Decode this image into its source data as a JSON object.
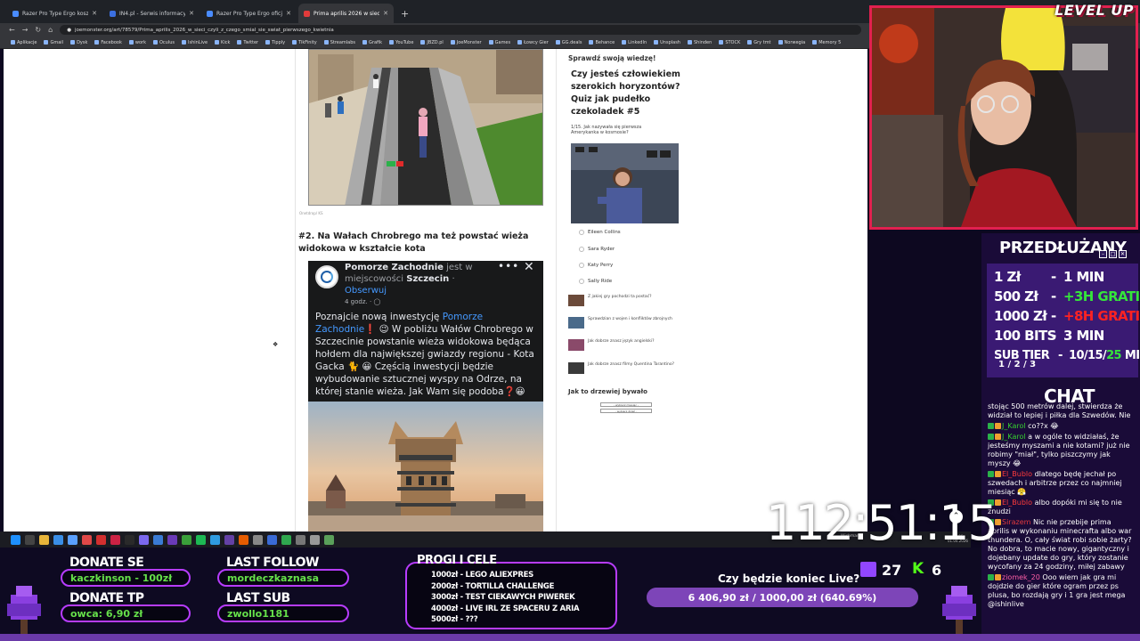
{
  "browser": {
    "tabs": [
      {
        "title": "Razer Pro Type Ergo koszt - Sz",
        "color": "#4a8cff",
        "active": false
      },
      {
        "title": "IN4.pl - Serwis informacyjny | T",
        "color": "#3b6fe0",
        "active": false
      },
      {
        "title": "Razer Pro Type Ergo oficjalnie",
        "color": "#4a8cff",
        "active": false
      },
      {
        "title": "Prima aprilis 2026 w sieci, czyli",
        "color": "#e23b3b",
        "active": true
      }
    ],
    "url": "joemonster.org/art/78579/Prima_aprilis_2026_w_sieci_czyli_z_czego_smial_sie_swiat_pierwszego_kwietnia",
    "bookmarks": [
      "Aplikacje",
      "Gmail",
      "Dysk",
      "Facebook",
      "work",
      "Oculus",
      "IshinLive",
      "Kick",
      "Twitter",
      "Tipply",
      "TikFinity",
      "Streamlabs",
      "Grafik",
      "YouTube",
      "JBZD.pl",
      "JoeMonster",
      "Games",
      "Łowcy Gier",
      "GG.deals",
      "Behance",
      "LinkedIn",
      "Unsplash",
      "Shinden",
      "STOCK",
      "Gry tmt",
      "Norwegia",
      "Memory 5"
    ]
  },
  "article": {
    "photo_credit": "Onetdrop/ KS",
    "heading": "#2. Na Wałach Chrobrego ma też powstać wieża widokowa w kształcie kota",
    "fb": {
      "page_name": "Pomorze Zachodnie",
      "is_in": "jest w miejscowości",
      "city": "Szczecin",
      "follow": "Obserwuj",
      "time": "4 godz. · ",
      "text_1": "Poznajcie nową inwestycję ",
      "text_link": "Pomorze Zachodnie",
      "text_2": "❗ 😉 W pobliżu Wałów Chrobrego w Szczecinie powstanie wieża widokowa będąca hołdem dla największej gwiazdy regionu - Kota Gacka 🐈 😀 Częścią inwestycji będzie wybudowanie sztucznej wyspy na Odrze, na której stanie wieża. Jak Wam się podoba❓😀"
    }
  },
  "sidebar": {
    "section_title": "Sprawdź swoją wiedzę!",
    "quiz_title": "Czy jesteś człowiekiem szerokich horyzontów? Quiz jak pudełko czekoladek #5",
    "question": "1/15. Jak nazywała się pierwsza Amerykanka w kosmosie?",
    "options": [
      "Eileen Collins",
      "Sara Ryder",
      "Katy Perry",
      "Sally Ride"
    ],
    "related": [
      "Z jakiej gry pochodzi ta postać?",
      "Sprawdzian z wojen i konfliktów zbrojnych",
      "Jak dobrze znasz język angielski?",
      "Jak dobrze znasz filmy Quentina Tarantino?"
    ],
    "tree_title": "Jak to drzewiej bywało",
    "select_1": "- wybierz miesiąc -",
    "select_2": "- wybierz dzień -"
  },
  "taskbar": {
    "tray_name": "Wichmann",
    "time": "18:06",
    "date": "01.04.2026"
  },
  "overlay": {
    "brand": "LEVEL UP",
    "extend_title": "PRZEDŁUŻANY",
    "rows": [
      {
        "amount": "1 Zł",
        "reward": "1 MIN",
        "kind": "plain"
      },
      {
        "amount": "500 Zł",
        "reward": "+3H GRATIS",
        "kind": "green"
      },
      {
        "amount": "1000 Zł",
        "reward": "+8H GRATIS",
        "kind": "red"
      },
      {
        "amount": "100 BITS",
        "reward": "3 MIN",
        "kind": "plain"
      }
    ],
    "sub_tier_label": "SUB TIER",
    "sub_tier_levels": "1 / 2 / 3",
    "sub_tier_values": "10/15/",
    "sub_tier_last": "25",
    "sub_tier_unit": " MIN",
    "chat_title": "CHAT",
    "chat": [
      {
        "name": "",
        "text": "stojąc 500 metrów dalej, stwierdza że widział to lepiej i piłka dla Szwedów. Nie",
        "cls": ""
      },
      {
        "name": "J_Karol",
        "text": "co??x 😂",
        "cls": ""
      },
      {
        "name": "J_Karol",
        "text": "a w ogóle to widziałaś, że jesteśmy myszami a nie kotami? już nie robimy \"miał\", tylko piszczymy jak myszy 😂",
        "cls": ""
      },
      {
        "name": "El_Bublo",
        "text": "dlatego będę jechał po szwedach i arbitrze przez co najmniej miesiąc 😤",
        "cls": "red"
      },
      {
        "name": "El_Bublo",
        "text": "albo dopóki mi się to nie znudzi",
        "cls": "red"
      },
      {
        "name": "Sirazem",
        "text": "Nic nie przebije prima aprilis w wykonaniu minecrafta albo war thundera. O, cały świat robi sobie żarty? No dobra, to macie nowy, gigantyczny i dojebany update do gry, który zostanie wycofany za 24 godziny, miłej zabawy",
        "cls": "dred"
      },
      {
        "name": "ziomek_20",
        "text": "Ooo wiem jak gra mi dojdzie do gier które ogram przez ps plusa, bo rozdają gry i 1 gra jest mega @ishinlive",
        "cls": "pink"
      }
    ],
    "timer": "112:51:15",
    "donate_se_label": "DONATE SE",
    "donate_se_value": "kaczkinson - 100zł",
    "donate_tp_label": "DONATE TP",
    "donate_tp_value": "owca: 6,90 zł",
    "last_follow_label": "LAST FOLLOW",
    "last_follow_value": "mordeczkaznasa",
    "last_sub_label": "LAST SUB",
    "last_sub_value": "zwollo1181",
    "progi_title": "PROGI I CELE",
    "progi": [
      "1000zł - LEGO ALIEXPRES",
      "2000zł - TORTILLA CHALLENGE",
      "3000zł - TEST CIEKAWYCH PIWEREK",
      "4000zł - LIVE IRL ZE SPACERU Z ARIA",
      "5000zł - ???"
    ],
    "goal_title": "Czy będzie koniec Live?",
    "goal_text": "6 406,90 zł / 1000,00 zł (640.69%)",
    "goal_fraction": 1.0,
    "twitch_viewers": "27",
    "kick_viewers": "6"
  }
}
